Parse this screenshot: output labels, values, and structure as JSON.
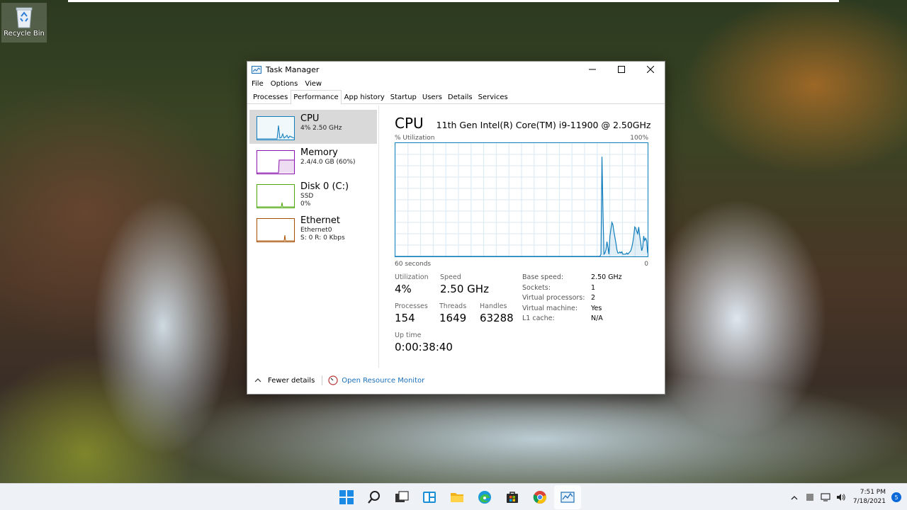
{
  "desktop": {
    "recycle_bin_label": "Recycle Bin"
  },
  "window": {
    "title": "Task Manager",
    "menus": [
      "File",
      "Options",
      "View"
    ],
    "tabs": [
      "Processes",
      "Performance",
      "App history",
      "Startup",
      "Users",
      "Details",
      "Services"
    ],
    "active_tab": "Performance"
  },
  "devices": [
    {
      "name": "CPU",
      "sub": "4% 2.50 GHz",
      "sub2": "",
      "color": "#117dbb"
    },
    {
      "name": "Memory",
      "sub": "2.4/4.0 GB (60%)",
      "sub2": "",
      "color": "#8b12ae"
    },
    {
      "name": "Disk 0 (C:)",
      "sub": "SSD",
      "sub2": "0%",
      "color": "#4da60c"
    },
    {
      "name": "Ethernet",
      "sub": "Ethernet0",
      "sub2": "S: 0 R: 0 Kbps",
      "color": "#a74f01"
    }
  ],
  "cpu": {
    "title": "CPU",
    "model": "11th Gen Intel(R) Core(TM) i9-11900 @ 2.50GHz",
    "util_label": "% Utilization",
    "util_max": "100%",
    "axis_left": "60 seconds",
    "axis_right": "0",
    "utilization_history": [
      0,
      0,
      0,
      0,
      0,
      0,
      0,
      0,
      0,
      0,
      0,
      0,
      0,
      0,
      0,
      0,
      0,
      0,
      0,
      0,
      0,
      0,
      0,
      0,
      0,
      0,
      0,
      0,
      0,
      0,
      0,
      0,
      0,
      0,
      0,
      0,
      0,
      0,
      0,
      0,
      0,
      0,
      0,
      0,
      0,
      0,
      0,
      0,
      0,
      0,
      0,
      0,
      0,
      0,
      0,
      0,
      0,
      0,
      0,
      0,
      0,
      0,
      0,
      0,
      0,
      0,
      0,
      0,
      0,
      0,
      0,
      0,
      0,
      0,
      0,
      0,
      0,
      0,
      0,
      0,
      0,
      0,
      0,
      0,
      0,
      0,
      0,
      0,
      0,
      0,
      0,
      0,
      0,
      0,
      0,
      0,
      0,
      0,
      0,
      0,
      0,
      0,
      0,
      0,
      0,
      0,
      0,
      0,
      0,
      0,
      0,
      0,
      0,
      0,
      0,
      0,
      0,
      0,
      0,
      0,
      0,
      0,
      0,
      0,
      0,
      0,
      0,
      0,
      0,
      0,
      0,
      0,
      0,
      0,
      0,
      0,
      0,
      0,
      0,
      0,
      0,
      0,
      0,
      0,
      0,
      0,
      0,
      0,
      0,
      0,
      0,
      0,
      0,
      0,
      0,
      0,
      0,
      0,
      0,
      0,
      0,
      0,
      0,
      0,
      0,
      0,
      0,
      0,
      0,
      0,
      0,
      0,
      0,
      0,
      0,
      0,
      0,
      0,
      0,
      0,
      0,
      0,
      0,
      0,
      0,
      0,
      0,
      0,
      0,
      0,
      0,
      0,
      0,
      0,
      0,
      0,
      0,
      0,
      0,
      0,
      0,
      0,
      0,
      0,
      0,
      0,
      0,
      2,
      88,
      40,
      2,
      3,
      6,
      13,
      8,
      2,
      18,
      24,
      30,
      28,
      22,
      17,
      12,
      6,
      3,
      3,
      4,
      3,
      4,
      2,
      2,
      2,
      2,
      3,
      2,
      3,
      4,
      5,
      8,
      12,
      18,
      26,
      25,
      22,
      20,
      26,
      18,
      12,
      5,
      8,
      18,
      14,
      16,
      14,
      3
    ],
    "stats": {
      "utilization_label": "Utilization",
      "utilization": "4%",
      "speed_label": "Speed",
      "speed": "2.50 GHz",
      "processes_label": "Processes",
      "processes": "154",
      "threads_label": "Threads",
      "threads": "1649",
      "handles_label": "Handles",
      "handles": "63288",
      "uptime_label": "Up time",
      "uptime": "0:00:38:40"
    },
    "specs": [
      {
        "k": "Base speed:",
        "v": "2.50 GHz"
      },
      {
        "k": "Sockets:",
        "v": "1"
      },
      {
        "k": "Virtual processors:",
        "v": "2"
      },
      {
        "k": "Virtual machine:",
        "v": "Yes"
      },
      {
        "k": "L1 cache:",
        "v": "N/A"
      }
    ]
  },
  "footer": {
    "fewer_details": "Fewer details",
    "open_resource_monitor": "Open Resource Monitor"
  },
  "taskbar": {
    "icons": [
      "start-icon",
      "search-icon",
      "task-view-icon",
      "widgets-icon",
      "file-explorer-icon",
      "edge-icon",
      "store-icon",
      "chrome-icon",
      "task-manager-icon"
    ],
    "time": "7:51 PM",
    "date": "7/18/2021",
    "notification_count": "5"
  }
}
